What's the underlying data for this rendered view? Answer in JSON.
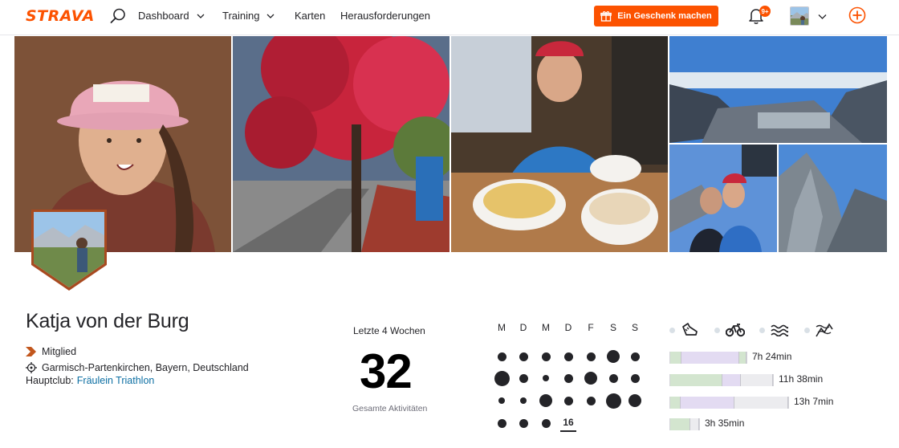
{
  "nav": {
    "logo": "STRAVA",
    "items": [
      {
        "label": "Dashboard",
        "has_dropdown": true
      },
      {
        "label": "Training",
        "has_dropdown": true
      },
      {
        "label": "Karten",
        "has_dropdown": false
      },
      {
        "label": "Herausforderungen",
        "has_dropdown": false
      }
    ],
    "gift_label": "Ein Geschenk machen",
    "notification_badge": "9+",
    "icons": [
      "search-icon",
      "gift-icon",
      "bell-icon",
      "chevron-down-icon",
      "add-icon"
    ],
    "accent_color": "#fc5200"
  },
  "profile": {
    "name": "Katja von der Burg",
    "membership": "Mitglied",
    "location": "Garmisch-Partenkirchen, Bayern, Deutschland",
    "club_label": "Hauptclub:",
    "club_name": "Fräulein Triathlon"
  },
  "stats": {
    "period_label": "Letzte 4 Wochen",
    "total_activities": "32",
    "total_label": "Gesamte Aktivitäten"
  },
  "week_grid": {
    "days": [
      "M",
      "D",
      "M",
      "D",
      "F",
      "S",
      "S"
    ],
    "today_label": "16",
    "activity_intensity": [
      [
        1,
        1,
        1,
        1,
        1,
        2,
        1
      ],
      [
        3,
        1,
        0,
        1,
        2,
        1,
        1
      ],
      [
        0,
        0,
        2,
        1,
        1,
        3,
        2
      ],
      [
        1,
        1,
        1
      ]
    ]
  },
  "sports": [
    {
      "name": "run-icon",
      "active": true
    },
    {
      "name": "bike-icon",
      "active": false
    },
    {
      "name": "swim-icon",
      "active": false
    },
    {
      "name": "other-sport-icon",
      "active": false
    }
  ],
  "training_bars": [
    {
      "time": "7h 24min",
      "segments": [
        {
          "fill": 0.08,
          "color": "#d3e5cf"
        },
        {
          "fill": 0.4,
          "color": "#e3dbf2"
        },
        {
          "fill": 0.05,
          "color": "#d3e5cf"
        }
      ],
      "total_fill": 0.53
    },
    {
      "time": "11h 38min",
      "segments": [
        {
          "fill": 0.36,
          "color": "#d3e5cf"
        },
        {
          "fill": 0.13,
          "color": "#e3dbf2"
        },
        {
          "fill": 0.22,
          "color": "#ececef"
        }
      ],
      "total_fill": 0.71
    },
    {
      "time": "13h 7min",
      "segments": [
        {
          "fill": 0.07,
          "color": "#d3e5cf"
        },
        {
          "fill": 0.37,
          "color": "#e3dbf2"
        },
        {
          "fill": 0.37,
          "color": "#ececef"
        }
      ],
      "total_fill": 0.81
    },
    {
      "time": "3h 35min",
      "segments": [
        {
          "fill": 0.14,
          "color": "#d3e5cf"
        },
        {
          "fill": 0.06,
          "color": "#ececef"
        }
      ],
      "total_fill": 0.2
    }
  ]
}
